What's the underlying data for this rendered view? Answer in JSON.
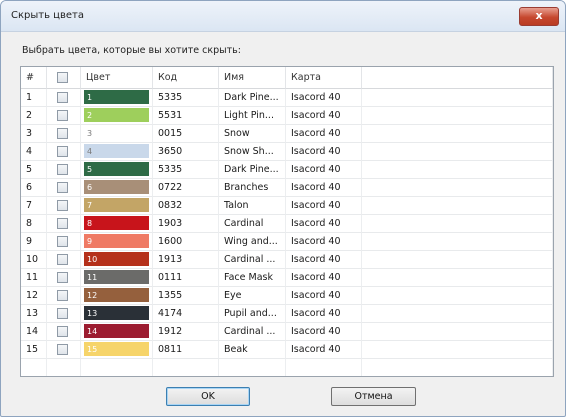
{
  "dialog": {
    "title": "Скрыть цвета",
    "close_label": "x",
    "instruction": "Выбрать цвета, которые вы хотите скрыть:"
  },
  "table": {
    "columns": {
      "num": "#",
      "color": "Цвет",
      "code": "Код",
      "name": "Имя",
      "map": "Карта"
    },
    "rows": [
      {
        "num": "1",
        "swatch": "1",
        "color": "#2e6b46",
        "code": "5335",
        "name": "Dark Pine...",
        "map": "Isacord 40"
      },
      {
        "num": "2",
        "swatch": "2",
        "color": "#9ecf5c",
        "code": "5531",
        "name": "Light Pin...",
        "map": "Isacord 40"
      },
      {
        "num": "3",
        "swatch": "3",
        "color": "#ffffff",
        "code": "0015",
        "name": "Snow",
        "map": "Isacord 40"
      },
      {
        "num": "4",
        "swatch": "4",
        "color": "#c9d8ea",
        "code": "3650",
        "name": "Snow Sh...",
        "map": "Isacord 40"
      },
      {
        "num": "5",
        "swatch": "5",
        "color": "#2e6b46",
        "code": "5335",
        "name": "Dark Pine...",
        "map": "Isacord 40"
      },
      {
        "num": "6",
        "swatch": "6",
        "color": "#a88f78",
        "code": "0722",
        "name": "Branches",
        "map": "Isacord 40"
      },
      {
        "num": "7",
        "swatch": "7",
        "color": "#c3a566",
        "code": "0832",
        "name": "Talon",
        "map": "Isacord 40"
      },
      {
        "num": "8",
        "swatch": "8",
        "color": "#c8141b",
        "code": "1903",
        "name": "Cardinal",
        "map": "Isacord 40"
      },
      {
        "num": "9",
        "swatch": "9",
        "color": "#ef7a64",
        "code": "1600",
        "name": "Wing and...",
        "map": "Isacord 40"
      },
      {
        "num": "10",
        "swatch": "10",
        "color": "#b5311b",
        "code": "1913",
        "name": "Cardinal ...",
        "map": "Isacord 40"
      },
      {
        "num": "11",
        "swatch": "11",
        "color": "#6b6b69",
        "code": "0111",
        "name": "Face Mask",
        "map": "Isacord 40"
      },
      {
        "num": "12",
        "swatch": "12",
        "color": "#95603d",
        "code": "1355",
        "name": "Eye",
        "map": "Isacord 40"
      },
      {
        "num": "13",
        "swatch": "13",
        "color": "#2a3037",
        "code": "4174",
        "name": "Pupil and...",
        "map": "Isacord 40"
      },
      {
        "num": "14",
        "swatch": "14",
        "color": "#9c1c30",
        "code": "1912",
        "name": "Cardinal ...",
        "map": "Isacord 40"
      },
      {
        "num": "15",
        "swatch": "15",
        "color": "#f6d46a",
        "code": "0811",
        "name": "Beak",
        "map": "Isacord 40"
      }
    ]
  },
  "buttons": {
    "ok": "OK",
    "cancel": "Отмена"
  }
}
